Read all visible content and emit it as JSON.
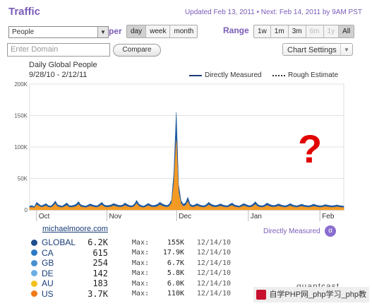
{
  "header": {
    "title": "Traffic",
    "updated": "Updated Feb 13, 2011 • Next: Feb 14, 2011 by 9AM PST"
  },
  "controls": {
    "metric_select": "People",
    "per_label": "per",
    "per_options": [
      "day",
      "week",
      "month"
    ],
    "per_selected": "day",
    "range_label": "Range",
    "range_options": [
      "1w",
      "1m",
      "3m",
      "6m",
      "1y",
      "All"
    ],
    "range_selected": "All",
    "range_disabled": [
      "6m",
      "1y"
    ],
    "domain_placeholder": "Enter Domain",
    "compare_label": "Compare",
    "chart_settings_label": "Chart Settings"
  },
  "chart_data": {
    "type": "area",
    "title": "Daily Global People",
    "subtitle": "9/28/10 - 2/12/11",
    "legend": [
      "Directly Measured",
      "Rough Estimate"
    ],
    "legend_placement": "top-right",
    "y_ticks": [
      "200K",
      "150K",
      "100K",
      "50K",
      "0"
    ],
    "ylim": [
      0,
      200000
    ],
    "x_ticks": [
      "Oct",
      "Nov",
      "Dec",
      "Jan",
      "Feb"
    ],
    "grid": true,
    "series": [
      {
        "name": "GLOBAL",
        "color": "#1f5aa0",
        "values": [
          6000,
          7000,
          5000,
          12000,
          9000,
          6500,
          8000,
          10000,
          7000,
          6000,
          9000,
          14000,
          8000,
          7000,
          6000,
          8500,
          11000,
          7000,
          6500,
          7500,
          9000,
          13000,
          8000,
          7000,
          6000,
          7500,
          9500,
          8000,
          7000,
          6500,
          9000,
          12000,
          8000,
          6800,
          7200,
          8000,
          10000,
          9000,
          7500,
          7000,
          8000,
          11000,
          8500,
          7000,
          6500,
          9000,
          15000,
          9000,
          7000,
          6000,
          8000,
          10500,
          8000,
          7000,
          7500,
          9000,
          12000,
          9500,
          8000,
          7000,
          9000,
          16000,
          60000,
          155000,
          40000,
          15000,
          9000,
          11000,
          20000,
          9000,
          7000,
          8000,
          10000,
          8000,
          7000,
          6500,
          8500,
          12000,
          9000,
          7500,
          7000,
          8000,
          9500,
          8000,
          7000,
          6500,
          9000,
          11000,
          8000,
          7000,
          6000,
          8000,
          10000,
          8500,
          7000,
          6800,
          9000,
          13000,
          8500,
          7000,
          6500,
          8000,
          11000,
          9000,
          7500,
          7000,
          8000,
          9500,
          8000,
          7000,
          6500,
          8000,
          10000,
          8000,
          7000,
          6500,
          8000,
          9000,
          7500,
          7000,
          6500,
          7500,
          9000,
          8000,
          7000,
          6500,
          7000,
          8500,
          7500,
          7000,
          6500,
          7000,
          8000,
          7000,
          6500,
          6000
        ]
      },
      {
        "name": "US",
        "color": "#f39a25",
        "values": [
          3500,
          4200,
          3000,
          8000,
          6000,
          4000,
          5000,
          6500,
          4300,
          3600,
          5600,
          9500,
          5000,
          4300,
          3600,
          5200,
          7000,
          4200,
          3900,
          4600,
          5600,
          8500,
          5000,
          4300,
          3600,
          4600,
          6000,
          5000,
          4300,
          3900,
          5600,
          8000,
          5000,
          4100,
          4400,
          5000,
          6500,
          5600,
          4600,
          4300,
          5000,
          7000,
          5300,
          4300,
          3900,
          5600,
          10000,
          5600,
          4300,
          3600,
          5000,
          6800,
          5000,
          4300,
          4600,
          5600,
          8000,
          6000,
          5000,
          4300,
          5600,
          11000,
          42000,
          110000,
          28000,
          10000,
          5600,
          7000,
          13000,
          5600,
          4300,
          5000,
          6500,
          5000,
          4300,
          3900,
          5300,
          8000,
          5600,
          4600,
          4300,
          5000,
          6000,
          5000,
          4300,
          3900,
          5600,
          7000,
          5000,
          4300,
          3600,
          5000,
          6500,
          5300,
          4300,
          4100,
          5600,
          8500,
          5300,
          4300,
          3900,
          5000,
          7000,
          5600,
          4600,
          4300,
          5000,
          6000,
          5000,
          4300,
          3900,
          5000,
          6500,
          5000,
          4300,
          3900,
          5000,
          5600,
          4600,
          4300,
          3900,
          4600,
          5600,
          5000,
          4300,
          3900,
          4300,
          5300,
          4600,
          4300,
          3900,
          4300,
          5000,
          4300,
          3900,
          3600
        ]
      }
    ]
  },
  "site": "michaelmoore.com",
  "directly_measured": "Directly Measured",
  "alpha_symbol": "α",
  "country_rows": [
    {
      "code": "GLOBAL",
      "value": "6.2K",
      "max_label": "Max:",
      "max": "155K",
      "date": "12/14/10",
      "color": "#1f4f8c"
    },
    {
      "code": "CA",
      "value": "615",
      "max_label": "Max:",
      "max": "17.9K",
      "date": "12/14/10",
      "color": "#2a79c4"
    },
    {
      "code": "GB",
      "value": "254",
      "max_label": "Max:",
      "max": "6.7K",
      "date": "12/14/10",
      "color": "#4a90d0"
    },
    {
      "code": "DE",
      "value": "142",
      "max_label": "Max:",
      "max": "5.8K",
      "date": "12/14/10",
      "color": "#6cb0e3"
    },
    {
      "code": "AU",
      "value": "183",
      "max_label": "Max:",
      "max": "6.0K",
      "date": "12/14/10",
      "color": "#f4c020"
    },
    {
      "code": "US",
      "value": "3.7K",
      "max_label": "Max:",
      "max": "110K",
      "date": "12/14/10",
      "color": "#f07a18"
    }
  ],
  "annotation": "?",
  "brand": "quantcast",
  "watermark": "自学PHP网_php学习_php教"
}
